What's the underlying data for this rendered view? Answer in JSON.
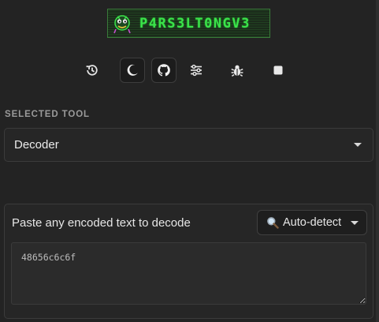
{
  "app": {
    "logo_text": "P4RS3LT0NGV3"
  },
  "toolbar": {
    "buttons": [
      {
        "icon": "history-icon",
        "active": false
      },
      {
        "icon": "moon-icon",
        "active": true
      },
      {
        "icon": "github-icon",
        "active": true
      },
      {
        "icon": "sliders-icon",
        "active": false
      },
      {
        "icon": "bug-icon",
        "active": false
      },
      {
        "icon": "square-icon",
        "active": false
      }
    ]
  },
  "tool": {
    "section_label": "SELECTED TOOL",
    "selected": "Decoder"
  },
  "decoder": {
    "label": "Paste any encoded text to decode",
    "mode_icon": "magnifier-icon",
    "mode": "Auto-detect",
    "input_value": "48656c6c6f"
  },
  "colors": {
    "background": "#232323",
    "logo_green": "#3be34a",
    "panel": "#262626",
    "border": "#3b3b3b"
  }
}
